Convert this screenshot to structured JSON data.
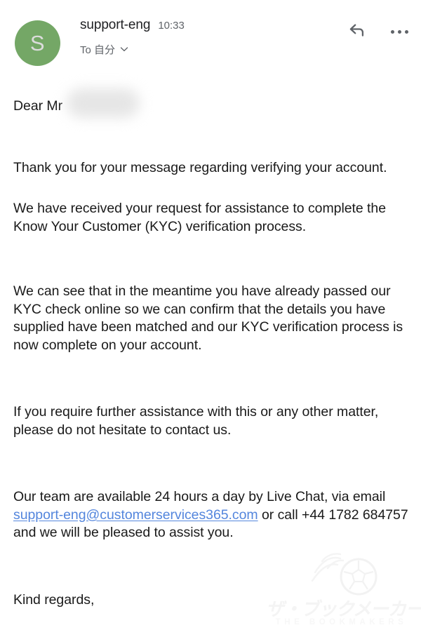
{
  "header": {
    "avatar_initial": "S",
    "avatar_color": "#74a766",
    "sender": "support-eng",
    "time": "10:33",
    "recipient": "To 自分",
    "reply_icon": "reply-arrow-icon",
    "more_icon": "more-options-icon",
    "expand_icon": "chevron-down-icon"
  },
  "body": {
    "greeting": "Dear Mr",
    "redaction_label": "redacted-name",
    "paragraphs": [
      "Thank you for your message regarding verifying your account.",
      "We have received your request for assistance to complete the Know Your Customer (KYC) verification process.",
      "We can see that in the meantime you have already passed our KYC check online so we can confirm that the details you have supplied have been matched and our KYC verification process is now complete on your account.",
      "If you require further assistance with this or any other matter, please do not hesitate to contact us."
    ],
    "contact_para": {
      "before": "Our team are available 24 hours a day by Live Chat, via email ",
      "email": "support-eng@customerservices365.com",
      "after": " or call +44 1782 684757 and we will be pleased to assist you."
    },
    "sign_off": "Kind regards,",
    "link_color": "#5486dd"
  },
  "watermark": {
    "icon": "flaming-soccer-ball-icon",
    "japanese": "ザ・ブックメーカーズ",
    "english": "THE BOOKMAKERS"
  }
}
